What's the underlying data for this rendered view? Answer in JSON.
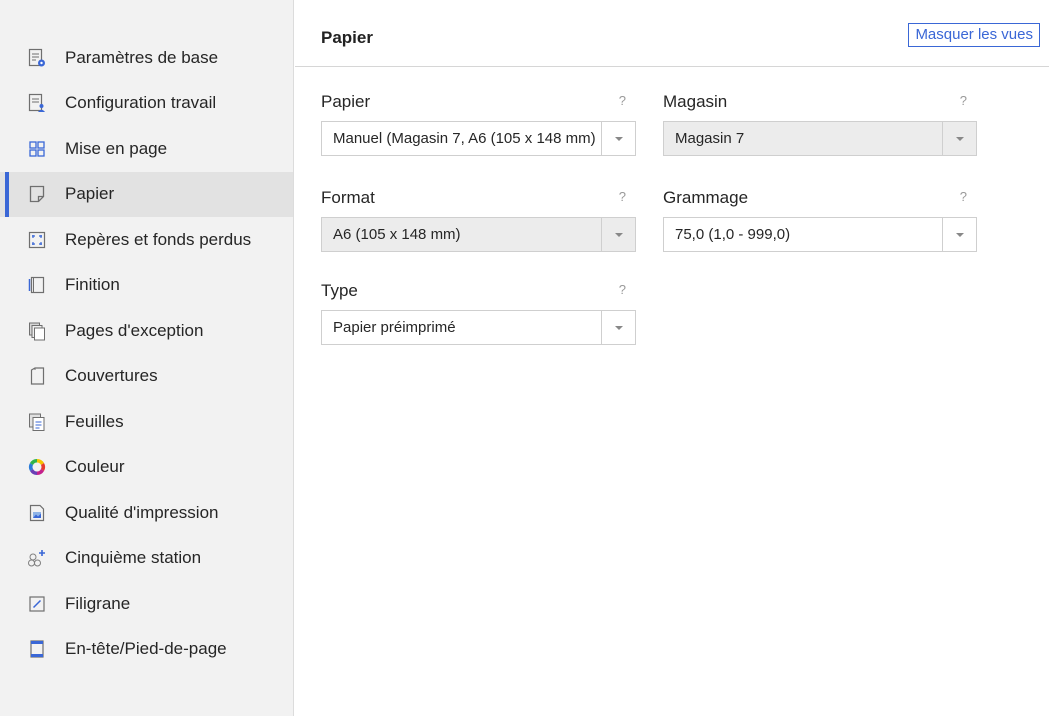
{
  "sidebar": {
    "items": [
      {
        "label": "Paramètres de base",
        "icon": "basic-settings-icon"
      },
      {
        "label": "Configuration travail",
        "icon": "job-config-icon"
      },
      {
        "label": "Mise en page",
        "icon": "layout-grid-icon"
      },
      {
        "label": "Papier",
        "icon": "paper-icon",
        "active": true
      },
      {
        "label": "Repères et fonds perdus",
        "icon": "crop-marks-icon"
      },
      {
        "label": "Finition",
        "icon": "finishing-icon"
      },
      {
        "label": "Pages d'exception",
        "icon": "exception-pages-icon"
      },
      {
        "label": "Couvertures",
        "icon": "covers-icon"
      },
      {
        "label": "Feuilles",
        "icon": "sheets-icon"
      },
      {
        "label": "Couleur",
        "icon": "color-wheel-icon"
      },
      {
        "label": "Qualité d'impression",
        "icon": "print-quality-icon"
      },
      {
        "label": "Cinquième station",
        "icon": "fifth-station-icon"
      },
      {
        "label": "Filigrane",
        "icon": "watermark-icon"
      },
      {
        "label": "En-tête/Pied-de-page",
        "icon": "header-footer-icon"
      }
    ],
    "accent_color": "#3a67d6"
  },
  "main": {
    "title": "Papier",
    "hide_views_label": "Masquer les vues",
    "help_symbol": "?",
    "fields": {
      "paper": {
        "label": "Papier",
        "value": "Manuel (Magasin 7, A6 (105 x 148 mm)",
        "disabled": false
      },
      "tray": {
        "label": "Magasin",
        "value": "Magasin 7",
        "disabled": true
      },
      "format": {
        "label": "Format",
        "value": "A6 (105 x 148 mm)",
        "disabled": true
      },
      "weight": {
        "label": "Grammage",
        "value": "75,0 (1,0 - 999,0)",
        "disabled": false
      },
      "type": {
        "label": "Type",
        "value": "Papier préimprimé",
        "disabled": false
      }
    }
  }
}
